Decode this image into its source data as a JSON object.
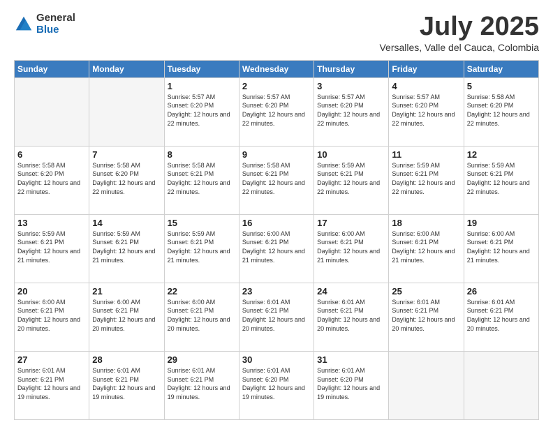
{
  "header": {
    "logo_general": "General",
    "logo_blue": "Blue",
    "month_title": "July 2025",
    "location": "Versalles, Valle del Cauca, Colombia"
  },
  "weekdays": [
    "Sunday",
    "Monday",
    "Tuesday",
    "Wednesday",
    "Thursday",
    "Friday",
    "Saturday"
  ],
  "weeks": [
    [
      {
        "day": "",
        "info": ""
      },
      {
        "day": "",
        "info": ""
      },
      {
        "day": "1",
        "info": "Sunrise: 5:57 AM\nSunset: 6:20 PM\nDaylight: 12 hours and 22 minutes."
      },
      {
        "day": "2",
        "info": "Sunrise: 5:57 AM\nSunset: 6:20 PM\nDaylight: 12 hours and 22 minutes."
      },
      {
        "day": "3",
        "info": "Sunrise: 5:57 AM\nSunset: 6:20 PM\nDaylight: 12 hours and 22 minutes."
      },
      {
        "day": "4",
        "info": "Sunrise: 5:57 AM\nSunset: 6:20 PM\nDaylight: 12 hours and 22 minutes."
      },
      {
        "day": "5",
        "info": "Sunrise: 5:58 AM\nSunset: 6:20 PM\nDaylight: 12 hours and 22 minutes."
      }
    ],
    [
      {
        "day": "6",
        "info": "Sunrise: 5:58 AM\nSunset: 6:20 PM\nDaylight: 12 hours and 22 minutes."
      },
      {
        "day": "7",
        "info": "Sunrise: 5:58 AM\nSunset: 6:20 PM\nDaylight: 12 hours and 22 minutes."
      },
      {
        "day": "8",
        "info": "Sunrise: 5:58 AM\nSunset: 6:21 PM\nDaylight: 12 hours and 22 minutes."
      },
      {
        "day": "9",
        "info": "Sunrise: 5:58 AM\nSunset: 6:21 PM\nDaylight: 12 hours and 22 minutes."
      },
      {
        "day": "10",
        "info": "Sunrise: 5:59 AM\nSunset: 6:21 PM\nDaylight: 12 hours and 22 minutes."
      },
      {
        "day": "11",
        "info": "Sunrise: 5:59 AM\nSunset: 6:21 PM\nDaylight: 12 hours and 22 minutes."
      },
      {
        "day": "12",
        "info": "Sunrise: 5:59 AM\nSunset: 6:21 PM\nDaylight: 12 hours and 22 minutes."
      }
    ],
    [
      {
        "day": "13",
        "info": "Sunrise: 5:59 AM\nSunset: 6:21 PM\nDaylight: 12 hours and 21 minutes."
      },
      {
        "day": "14",
        "info": "Sunrise: 5:59 AM\nSunset: 6:21 PM\nDaylight: 12 hours and 21 minutes."
      },
      {
        "day": "15",
        "info": "Sunrise: 5:59 AM\nSunset: 6:21 PM\nDaylight: 12 hours and 21 minutes."
      },
      {
        "day": "16",
        "info": "Sunrise: 6:00 AM\nSunset: 6:21 PM\nDaylight: 12 hours and 21 minutes."
      },
      {
        "day": "17",
        "info": "Sunrise: 6:00 AM\nSunset: 6:21 PM\nDaylight: 12 hours and 21 minutes."
      },
      {
        "day": "18",
        "info": "Sunrise: 6:00 AM\nSunset: 6:21 PM\nDaylight: 12 hours and 21 minutes."
      },
      {
        "day": "19",
        "info": "Sunrise: 6:00 AM\nSunset: 6:21 PM\nDaylight: 12 hours and 21 minutes."
      }
    ],
    [
      {
        "day": "20",
        "info": "Sunrise: 6:00 AM\nSunset: 6:21 PM\nDaylight: 12 hours and 20 minutes."
      },
      {
        "day": "21",
        "info": "Sunrise: 6:00 AM\nSunset: 6:21 PM\nDaylight: 12 hours and 20 minutes."
      },
      {
        "day": "22",
        "info": "Sunrise: 6:00 AM\nSunset: 6:21 PM\nDaylight: 12 hours and 20 minutes."
      },
      {
        "day": "23",
        "info": "Sunrise: 6:01 AM\nSunset: 6:21 PM\nDaylight: 12 hours and 20 minutes."
      },
      {
        "day": "24",
        "info": "Sunrise: 6:01 AM\nSunset: 6:21 PM\nDaylight: 12 hours and 20 minutes."
      },
      {
        "day": "25",
        "info": "Sunrise: 6:01 AM\nSunset: 6:21 PM\nDaylight: 12 hours and 20 minutes."
      },
      {
        "day": "26",
        "info": "Sunrise: 6:01 AM\nSunset: 6:21 PM\nDaylight: 12 hours and 20 minutes."
      }
    ],
    [
      {
        "day": "27",
        "info": "Sunrise: 6:01 AM\nSunset: 6:21 PM\nDaylight: 12 hours and 19 minutes."
      },
      {
        "day": "28",
        "info": "Sunrise: 6:01 AM\nSunset: 6:21 PM\nDaylight: 12 hours and 19 minutes."
      },
      {
        "day": "29",
        "info": "Sunrise: 6:01 AM\nSunset: 6:21 PM\nDaylight: 12 hours and 19 minutes."
      },
      {
        "day": "30",
        "info": "Sunrise: 6:01 AM\nSunset: 6:20 PM\nDaylight: 12 hours and 19 minutes."
      },
      {
        "day": "31",
        "info": "Sunrise: 6:01 AM\nSunset: 6:20 PM\nDaylight: 12 hours and 19 minutes."
      },
      {
        "day": "",
        "info": ""
      },
      {
        "day": "",
        "info": ""
      }
    ]
  ]
}
